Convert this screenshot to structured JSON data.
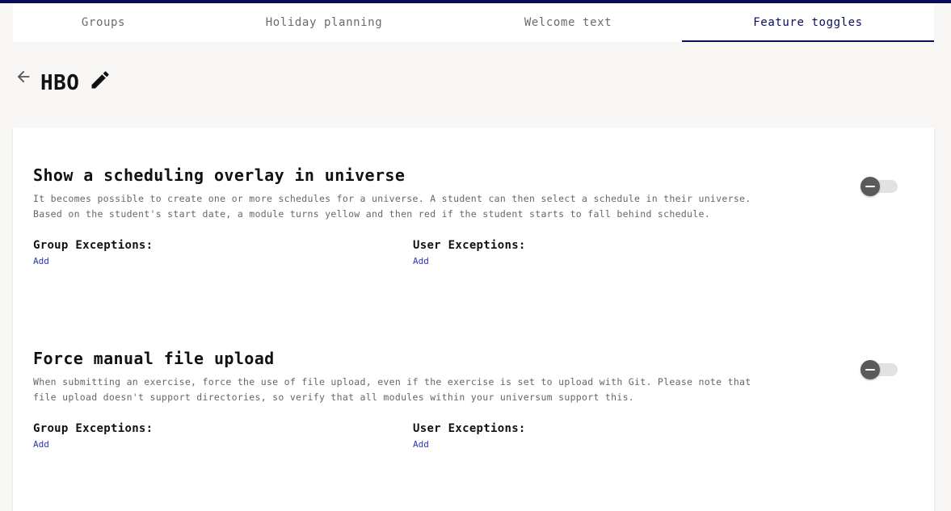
{
  "colors": {
    "accent": "#0b0b5c",
    "link": "#2a37b5",
    "background": "#f8f7f5"
  },
  "tabs": [
    {
      "label": "Groups"
    },
    {
      "label": "Holiday planning"
    },
    {
      "label": "Welcome text"
    },
    {
      "label": "Feature toggles",
      "active": true
    }
  ],
  "header": {
    "title": "HBO",
    "back_icon": "arrow-left-icon",
    "edit_icon": "pencil-icon"
  },
  "features": [
    {
      "title": "Show a scheduling overlay in universe",
      "description": "It becomes possible to create one or more schedules for a universe. A student can then select a schedule in their universe. Based on the student's start date, a module turns yellow and then red if the student starts to fall behind schedule.",
      "enabled": false,
      "group_exceptions_label": "Group Exceptions:",
      "group_add_label": "Add",
      "user_exceptions_label": "User Exceptions:",
      "user_add_label": "Add"
    },
    {
      "title": "Force manual file upload",
      "description": "When submitting an exercise, force the use of file upload, even if the exercise is set to upload with Git. Please note that file upload doesn't support directories, so verify that all modules within your universum support this.",
      "enabled": false,
      "group_exceptions_label": "Group Exceptions:",
      "group_add_label": "Add",
      "user_exceptions_label": "User Exceptions:",
      "user_add_label": "Add"
    }
  ]
}
